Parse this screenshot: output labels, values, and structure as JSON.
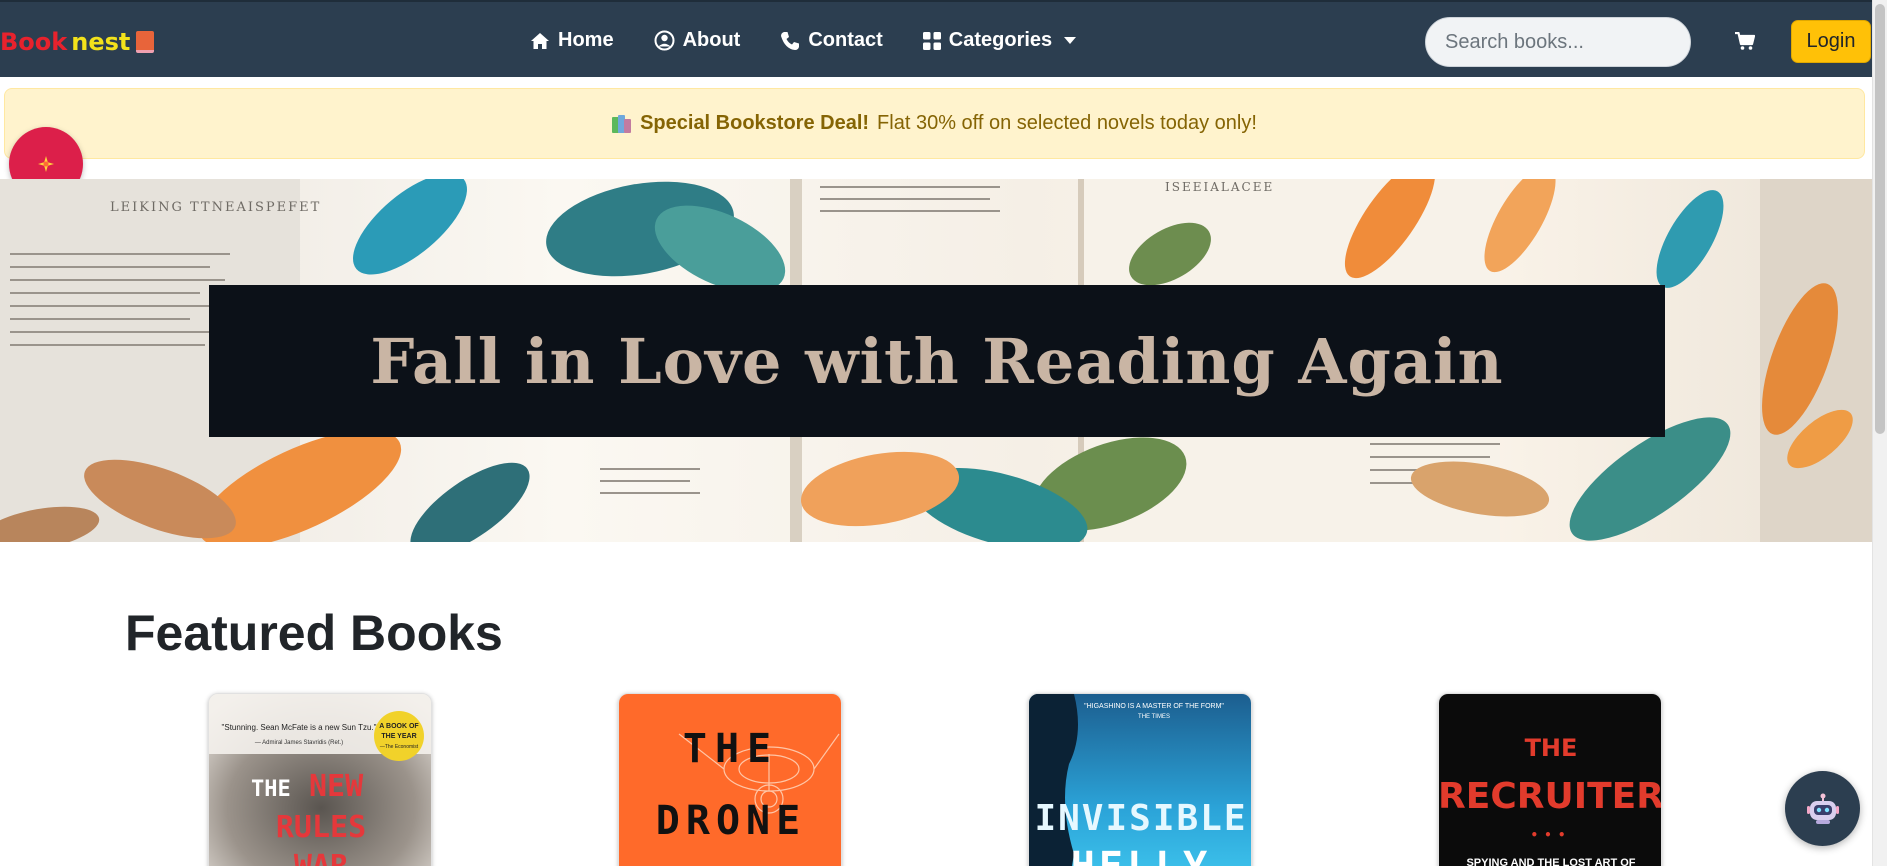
{
  "brand": {
    "part1": "Book",
    "part2": "nest"
  },
  "nav": {
    "items": [
      {
        "label": "Home",
        "icon": "home-icon"
      },
      {
        "label": "About",
        "icon": "user-circle-icon"
      },
      {
        "label": "Contact",
        "icon": "phone-icon"
      },
      {
        "label": "Categories",
        "icon": "grid-icon"
      }
    ]
  },
  "search": {
    "placeholder": "Search books..."
  },
  "cart": {
    "icon": "cart-icon"
  },
  "login": {
    "label": "Login"
  },
  "alert": {
    "icon": "books-icon",
    "strong": "Special Bookstore Deal!",
    "text": "Flat 30% off on selected novels today only!"
  },
  "hero": {
    "title": "Fall in Love with Reading Again"
  },
  "featured": {
    "title": "Featured Books",
    "books": [
      {
        "cover_quote": "\"Stunning. Sean McFate is a new Sun Tzu.\"",
        "cover_quote_author": "— Admiral James Stavridis (Ret.)",
        "badge_line1": "A BOOK OF",
        "badge_line2": "THE YEAR",
        "badge_line3": "—The Economist",
        "the": "THE",
        "title1": "NEW",
        "title2": "RULES",
        "title3": "WAR"
      },
      {
        "line1": "THE",
        "line2": "DRONE"
      },
      {
        "quote": "\"HIGASHINO IS A MASTER OF THE FORM\"",
        "quote_source": "THE TIMES",
        "line1": "INVISIBLE",
        "line2": "HELLY"
      },
      {
        "line1": "THE",
        "line2": "RECRUITER",
        "subtitle": "SPYING AND THE LOST ART OF"
      }
    ]
  },
  "colors": {
    "navbar": "#2c3e50",
    "accent_yellow": "#ffc107",
    "alert_bg": "#fff3cd",
    "alert_text": "#856404",
    "fab": "#dc1f4a"
  }
}
